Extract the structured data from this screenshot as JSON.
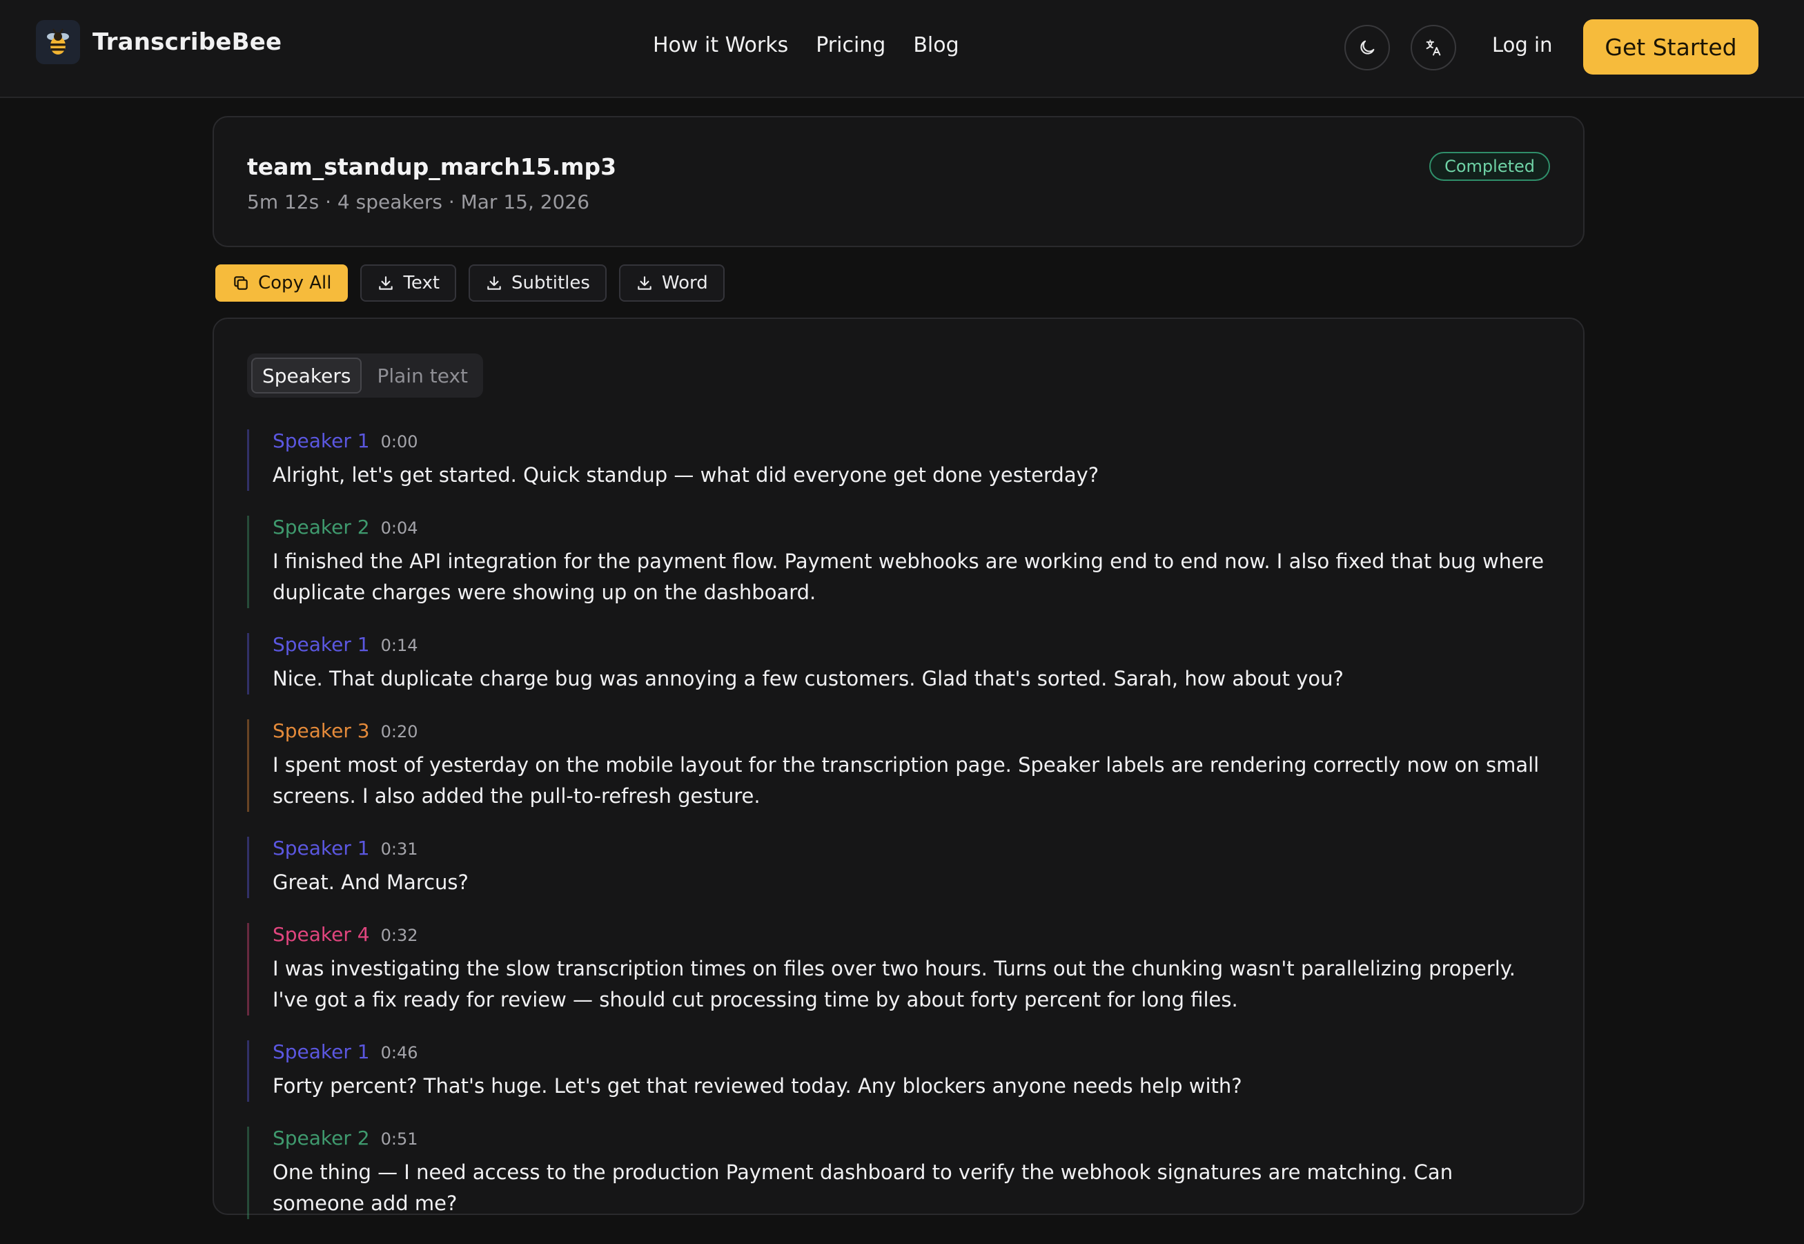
{
  "brand": {
    "name": "TranscribeBee"
  },
  "nav": {
    "items": [
      "How it Works",
      "Pricing",
      "Blog"
    ]
  },
  "header": {
    "login": "Log in",
    "cta": "Get Started"
  },
  "file": {
    "name": "team_standup_march15.mp3",
    "meta": "5m 12s · 4 speakers · Mar 15, 2026",
    "status": "Completed"
  },
  "toolbar": {
    "copy_all": "Copy All",
    "text": "Text",
    "subtitles": "Subtitles",
    "word": "Word"
  },
  "view_tabs": {
    "speakers": "Speakers",
    "plain": "Plain text"
  },
  "speaker_colors": {
    "Speaker 1": "#5b57e0",
    "Speaker 2": "#3f9a6e",
    "Speaker 3": "#e48a3a",
    "Speaker 4": "#e0457e"
  },
  "transcript": [
    {
      "speaker": "Speaker 1",
      "time": "0:00",
      "text": "Alright, let's get started. Quick standup — what did everyone get done yesterday?"
    },
    {
      "speaker": "Speaker 2",
      "time": "0:04",
      "text": "I finished the API integration for the payment flow. Payment webhooks are working end to end now. I also fixed that bug where duplicate charges were showing up on the dashboard."
    },
    {
      "speaker": "Speaker 1",
      "time": "0:14",
      "text": "Nice. That duplicate charge bug was annoying a few customers. Glad that's sorted. Sarah, how about you?"
    },
    {
      "speaker": "Speaker 3",
      "time": "0:20",
      "text": "I spent most of yesterday on the mobile layout for the transcription page. Speaker labels are rendering correctly now on small screens. I also added the pull-to-refresh gesture."
    },
    {
      "speaker": "Speaker 1",
      "time": "0:31",
      "text": "Great. And Marcus?"
    },
    {
      "speaker": "Speaker 4",
      "time": "0:32",
      "text": "I was investigating the slow transcription times on files over two hours. Turns out the chunking wasn't parallelizing properly. I've got a fix ready for review — should cut processing time by about forty percent for long files."
    },
    {
      "speaker": "Speaker 1",
      "time": "0:46",
      "text": "Forty percent? That's huge. Let's get that reviewed today. Any blockers anyone needs help with?"
    },
    {
      "speaker": "Speaker 2",
      "time": "0:51",
      "text": "One thing — I need access to the production Payment dashboard to verify the webhook signatures are matching. Can someone add me?"
    }
  ]
}
